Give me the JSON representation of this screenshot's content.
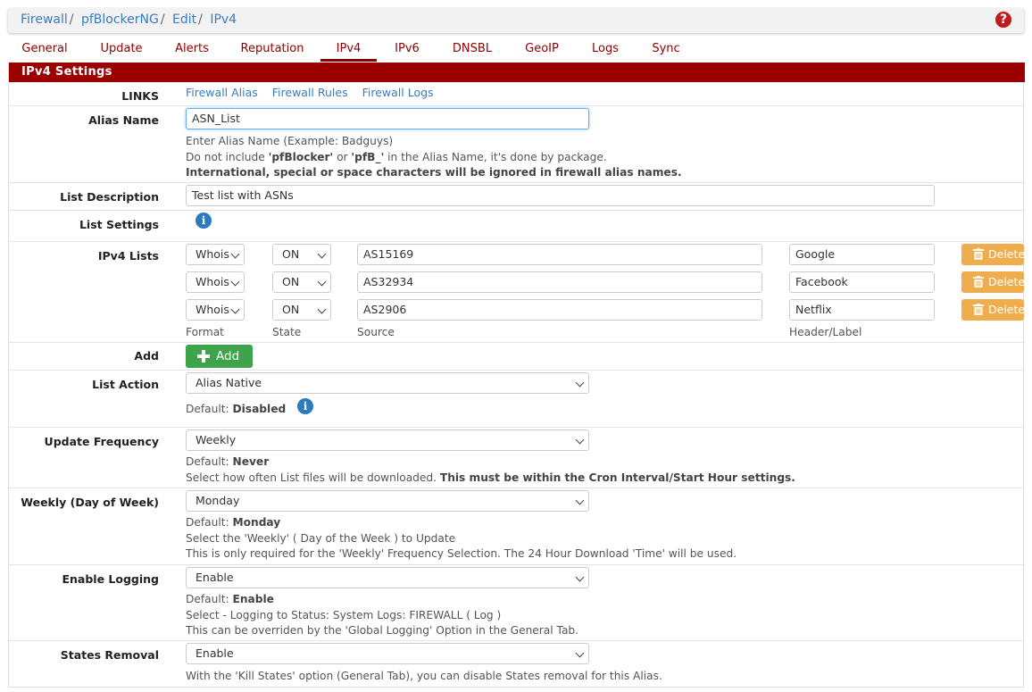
{
  "breadcrumb": [
    "Firewall",
    "pfBlockerNG",
    "Edit",
    "IPv4"
  ],
  "tabs": [
    "General",
    "Update",
    "Alerts",
    "Reputation",
    "IPv4",
    "IPv6",
    "DNSBL",
    "GeoIP",
    "Logs",
    "Sync"
  ],
  "active_tab": "IPv4",
  "panel_title": "IPv4 Settings",
  "links": {
    "label": "LINKS",
    "items": [
      "Firewall Alias",
      "Firewall Rules",
      "Firewall Logs"
    ]
  },
  "alias_name": {
    "label": "Alias Name",
    "value": "ASN_List",
    "help1": "Enter Alias Name (Example: Badguys)",
    "help2_pre": "Do not include ",
    "help2_b1": "'pfBlocker'",
    "help2_mid": " or ",
    "help2_b2": "'pfB_'",
    "help2_post": " in the Alias Name, it's done by package.",
    "help3": "International, special or space characters will be ignored in firewall alias names."
  },
  "list_description": {
    "label": "List Description",
    "value": "Test list with ASNs"
  },
  "list_settings": {
    "label": "List Settings"
  },
  "ipv4_lists": {
    "label": "IPv4 Lists",
    "rows": [
      {
        "format": "Whois",
        "state": "ON",
        "source": "AS15169",
        "header": "Google",
        "delete": "Delete"
      },
      {
        "format": "Whois",
        "state": "ON",
        "source": "AS32934",
        "header": "Facebook",
        "delete": "Delete"
      },
      {
        "format": "Whois",
        "state": "ON",
        "source": "AS2906",
        "header": "Netflix",
        "delete": "Delete"
      }
    ],
    "col_format": "Format",
    "col_state": "State",
    "col_source": "Source",
    "col_header": "Header/Label"
  },
  "add": {
    "label": "Add",
    "button": "Add"
  },
  "list_action": {
    "label": "List Action",
    "value": "Alias Native",
    "default_pre": "Default: ",
    "default_val": "Disabled"
  },
  "update_frequency": {
    "label": "Update Frequency",
    "value": "Weekly",
    "default_pre": "Default: ",
    "default_val": "Never",
    "help_pre": "Select how often List files will be downloaded. ",
    "help_bold": "This must be within the Cron Interval/Start Hour settings."
  },
  "weekly": {
    "label": "Weekly (Day of Week)",
    "value": "Monday",
    "default_pre": "Default: ",
    "default_val": "Monday",
    "help1": "Select the 'Weekly' ( Day of the Week ) to Update",
    "help2": "This is only required for the 'Weekly' Frequency Selection. The 24 Hour Download 'Time' will be used."
  },
  "enable_logging": {
    "label": "Enable Logging",
    "value": "Enable",
    "default_pre": "Default: ",
    "default_val": "Enable",
    "help1": "Select - Logging to Status: System Logs: FIREWALL ( Log )",
    "help2": "This can be overriden by the 'Global Logging' Option in the General Tab."
  },
  "states_removal": {
    "label": "States Removal",
    "value": "Enable",
    "help": "With the 'Kill States' option (General Tab), you can disable States removal for this Alias."
  },
  "colors": {
    "accent": "#9b0000",
    "link": "#3a7cc0",
    "add": "#3ea34a",
    "delete": "#f0ad4e",
    "info": "#2b7bc0"
  }
}
